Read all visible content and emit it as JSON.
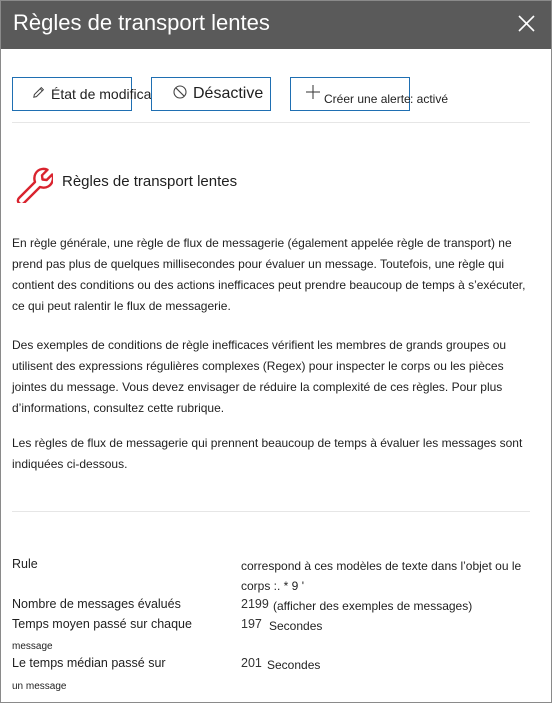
{
  "panel": {
    "title": "Règles de transport lentes",
    "close_icon": "close-icon"
  },
  "toolbar": {
    "edit_label": "État de modification",
    "edit_icon": "pencil-icon",
    "disable_label": "Désactive",
    "disable_icon": "blocked-circle-icon",
    "alert_label": "Créer une alerte",
    "alert_suffix": ": activé",
    "alert_icon": "plus-icon"
  },
  "section": {
    "icon": "wrench-icon",
    "icon_color": "#d9232e",
    "heading": "Règles de transport lentes"
  },
  "description": {
    "paragraph1": "En règle générale, une règle de flux de messagerie (également appelée règle de transport) ne prend pas plus de quelques millisecondes pour évaluer un message. Toutefois, une règle qui contient des conditions ou des actions inefficaces peut prendre beaucoup de temps à s’exécuter, ce qui peut ralentir le flux de messagerie.",
    "paragraph2": "Des exemples de conditions de règle inefficaces vérifient les membres de grands groupes ou utilisent des expressions régulières complexes (Regex) pour inspecter le corps ou les pièces jointes du message. Vous devez envisager de réduire la complexité de ces règles. Pour plus d’informations, consultez cette rubrique.",
    "paragraph3": "Les règles de flux de messagerie qui prennent beaucoup de temps à évaluer les messages sont indiquées ci-dessous."
  },
  "details": {
    "rule_label": "Rule",
    "rule_value": "correspond à ces modèles de texte dans l’objet ou le corps :. * 9 '",
    "messages_label": "Nombre de messages évalués",
    "messages_count": "2199",
    "messages_link": "(afficher des exemples de messages)",
    "avg_label": "Temps moyen passé sur chaque",
    "avg_label_small": "message",
    "avg_value": "197",
    "avg_unit": "Secondes",
    "median_label": "Le temps médian passé sur",
    "median_label_small": "un message",
    "median_value": "201",
    "median_unit": "Secondes"
  }
}
